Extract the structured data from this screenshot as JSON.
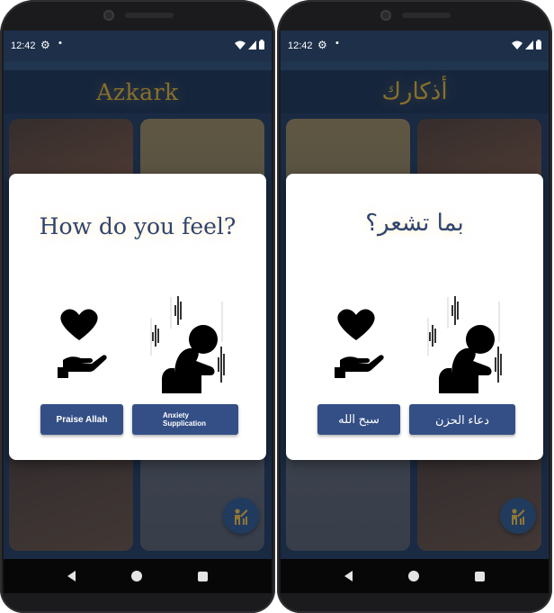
{
  "screens": [
    {
      "status_time": "12:42",
      "app_title": "Azkark",
      "dialog_title": "How do you feel?",
      "btn_praise": "Praise Allah",
      "btn_anxiety": "Anxiety Supplication"
    },
    {
      "status_time": "12:42",
      "app_title": "أذكارك",
      "dialog_title": "بما تشعر؟",
      "btn_praise": "سبح الله",
      "btn_anxiety": "دعاء الحزن"
    }
  ],
  "colors": {
    "dialog_title": "#2f4470",
    "button": "#344f86",
    "app_title_gold": "#c99f2c",
    "appbar": "#1a2d47"
  },
  "icons": [
    "settings-gear-icon",
    "notification-dot-icon",
    "wifi-icon",
    "signal-icon",
    "battery-icon",
    "heart-hand-icon",
    "sad-person-icon",
    "person-pray-icon",
    "back-icon",
    "home-icon",
    "recents-icon"
  ]
}
